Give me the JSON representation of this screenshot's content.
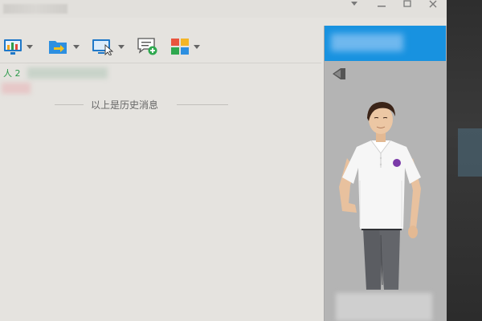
{
  "chat": {
    "member_count": "人 2",
    "history_divider": "以上是历史消息"
  },
  "icons": {
    "toolbar": [
      "chart-icon",
      "folder-transfer-icon",
      "screen-share-icon",
      "message-add-icon",
      "apps-grid-icon"
    ],
    "window": [
      "dropdown-icon",
      "minimize-icon",
      "maximize-icon",
      "close-icon"
    ],
    "panel": [
      "collapse-icon"
    ]
  },
  "colors": {
    "banner": "#1892e0",
    "member_count": "#2d9a4b",
    "window_bg": "#e5e3df"
  }
}
